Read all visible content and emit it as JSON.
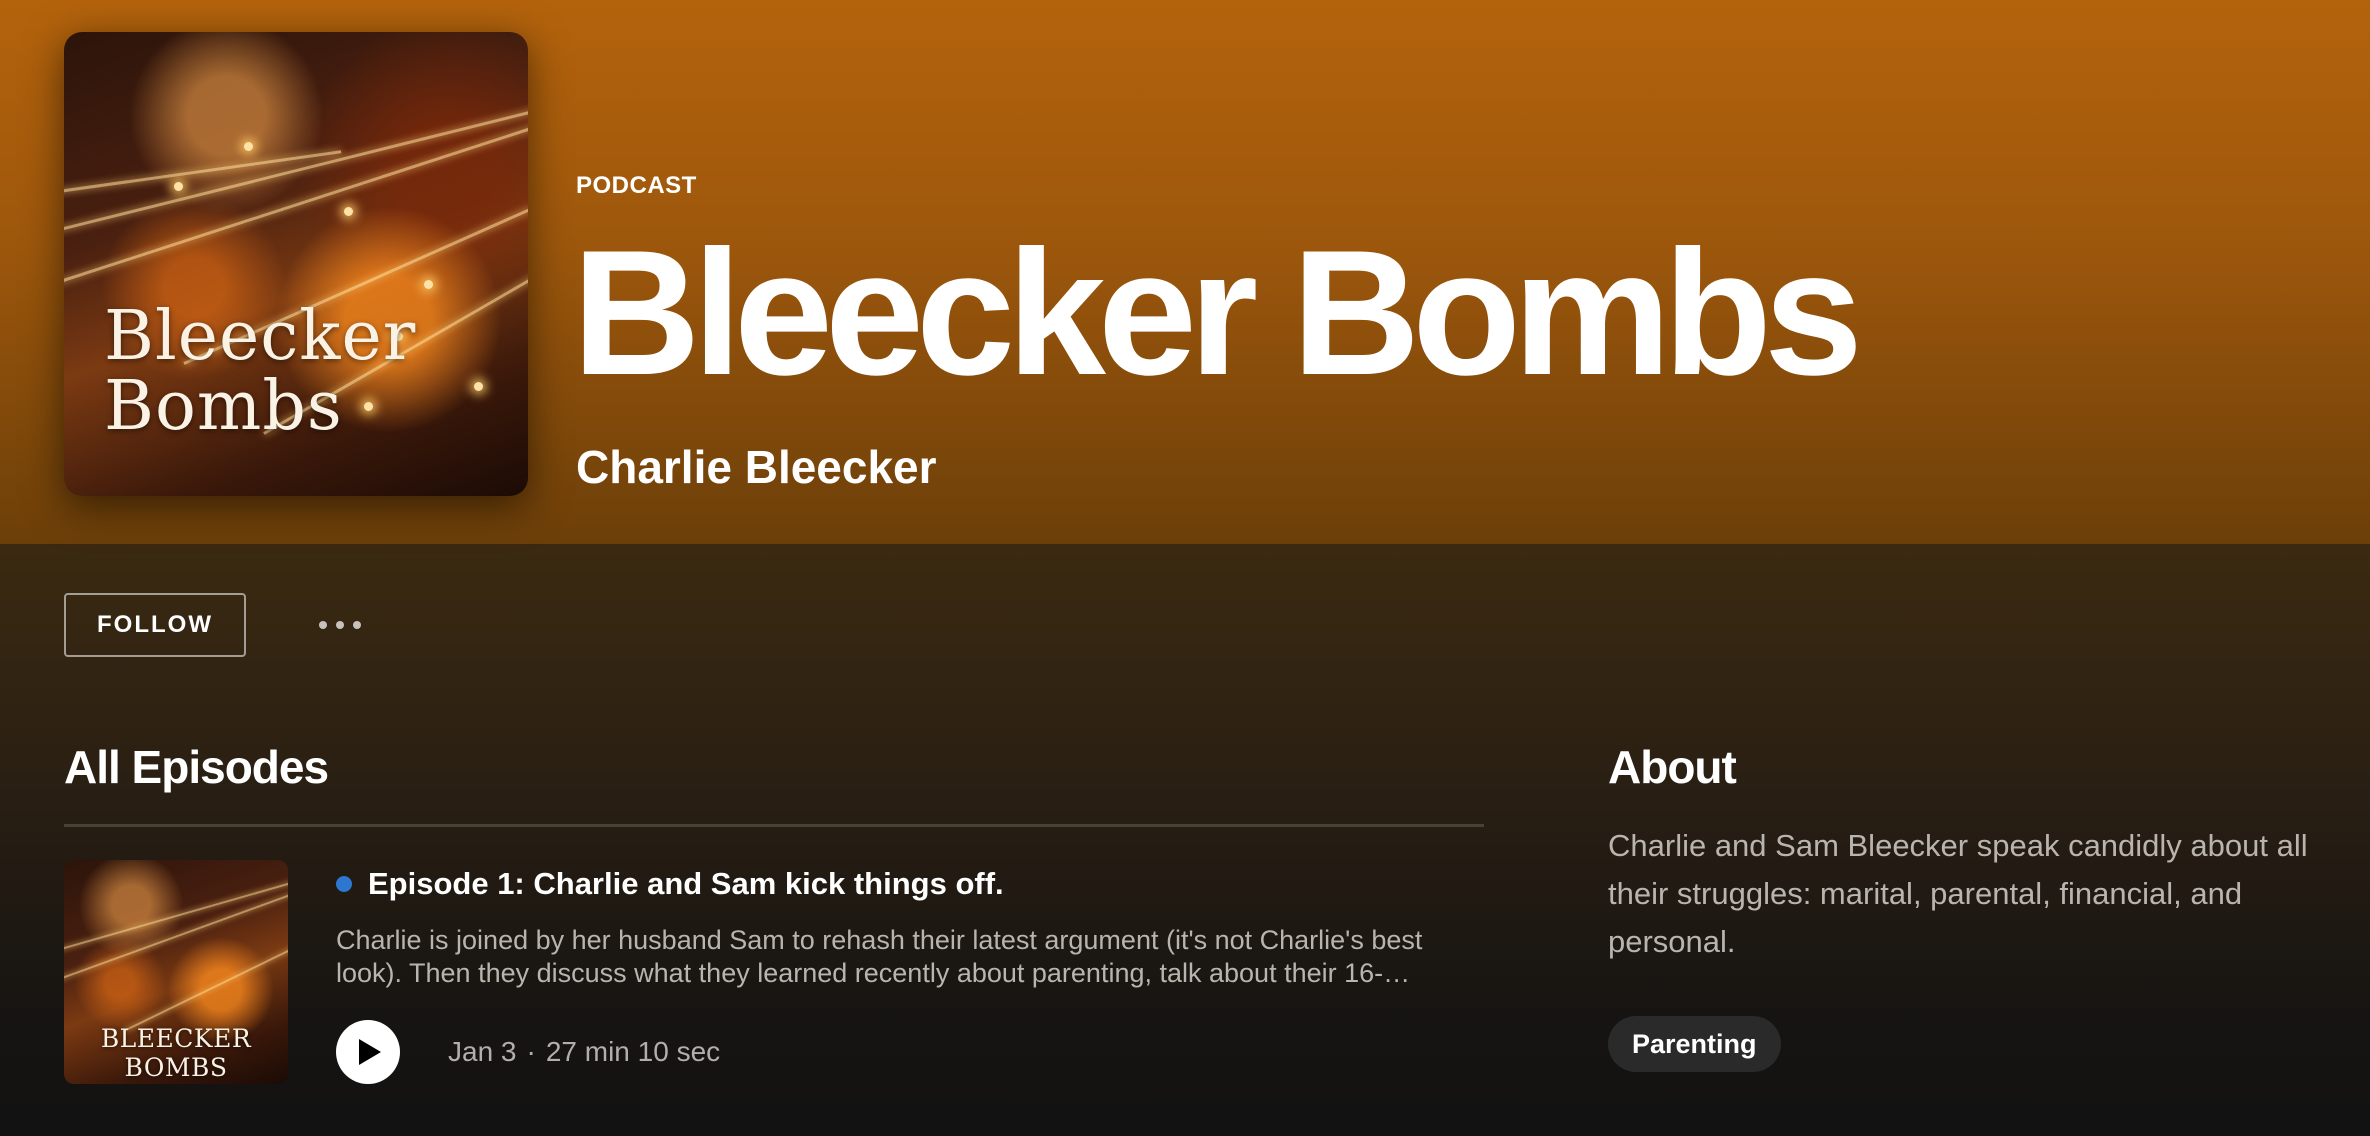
{
  "show": {
    "type_label": "PODCAST",
    "title": "Bleecker Bombs",
    "author": "Charlie Bleecker",
    "cover_text_line1": "Bleecker",
    "cover_text_line2": "Bombs"
  },
  "actions": {
    "follow_label": "FOLLOW",
    "more_icon": "more-horizontal-icon"
  },
  "episodes_section": {
    "heading": "All Episodes",
    "episodes": [
      {
        "title": "Episode 1: Charlie and Sam kick things off.",
        "description": "Charlie is joined by her husband Sam to rehash their latest argument (it's not Charlie's best look). Then they discuss what they learned recently about parenting, talk about their 16-…",
        "date": "Jan 3",
        "separator": "·",
        "duration": "27 min 10 sec",
        "thumb_text": "BLEECKER BOMBS",
        "is_new": true,
        "play_icon": "play-icon"
      }
    ]
  },
  "about": {
    "heading": "About",
    "text": "Charlie and Sam Bleecker speak candidly about all their struggles: marital, parental, financial, and personal.",
    "genre": "Parenting"
  },
  "colors": {
    "header_accent": "#b4630c",
    "new_dot": "#2e77d0",
    "chip_bg": "#2a2a2a",
    "background": "#121212"
  }
}
